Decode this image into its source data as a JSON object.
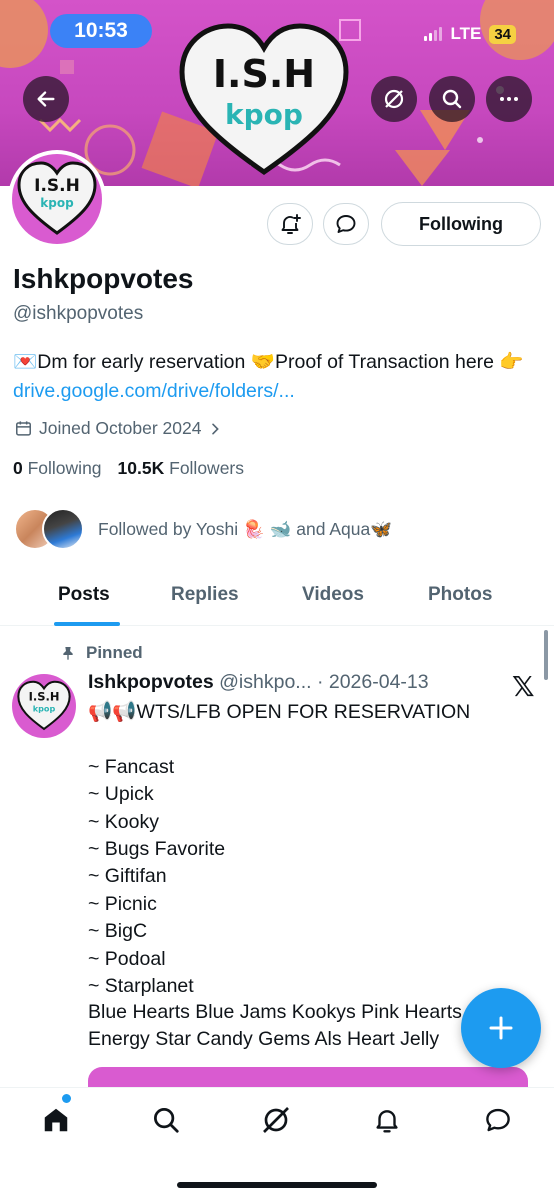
{
  "status_bar": {
    "time": "10:53",
    "network": "LTE",
    "battery": "34"
  },
  "banner": {
    "logo_title": "I.S.H",
    "logo_subtitle": "kpop"
  },
  "profile": {
    "avatar_title": "I.S.H",
    "avatar_subtitle": "kpop",
    "name": "Ishkpopvotes",
    "handle": "@ishkpopvotes",
    "bio_part1": "💌Dm for early reservation 🤝Proof of Transaction here 👉 ",
    "bio_link": "drive.google.com/drive/folders/...",
    "joined": "Joined October 2024",
    "following_count": "0",
    "following_label": "Following",
    "followers_count": "10.5K",
    "followers_label": "Followers",
    "followed_by": "Followed by Yoshi 🪼 🐋 and Aqua🦋",
    "follow_button": "Following"
  },
  "tabs": [
    {
      "label": "Posts",
      "active": true
    },
    {
      "label": "Replies",
      "active": false
    },
    {
      "label": "Videos",
      "active": false
    },
    {
      "label": "Photos",
      "active": false
    }
  ],
  "post": {
    "pinned_label": "Pinned",
    "author": "Ishkpopvotes",
    "meta": "@ishkpo... · 2026-04-13",
    "avatar_title": "I.S.H",
    "avatar_subtitle": "kpop",
    "body": "📢📢WTS/LFB OPEN FOR RESERVATION\n\n~ Fancast\n~ Upick\n~ Kooky\n~ Bugs Favorite\n~ Giftifan\n~ Picnic\n~ BigC\n~ Podoal\n~ Starplanet",
    "body_cut": "Blue Hearts Blue Jams Kookys Pink Hearts\nEnergy Star Candy Gems Als Heart Jelly"
  },
  "x_logo": "𝕏",
  "colors": {
    "accent": "#1d9bf0",
    "banner": "#c648be",
    "text": "#0f1419",
    "muted": "#536471"
  },
  "icons": {
    "back": "arrow-left-icon",
    "grok": "grok-icon",
    "search": "search-icon",
    "more": "more-icon",
    "notify": "bell-plus-icon",
    "message": "message-icon",
    "calendar": "calendar-icon",
    "pin": "pin-icon",
    "compose": "plus-icon",
    "home": "home-icon",
    "notifications": "bell-icon",
    "messages": "message-icon"
  }
}
